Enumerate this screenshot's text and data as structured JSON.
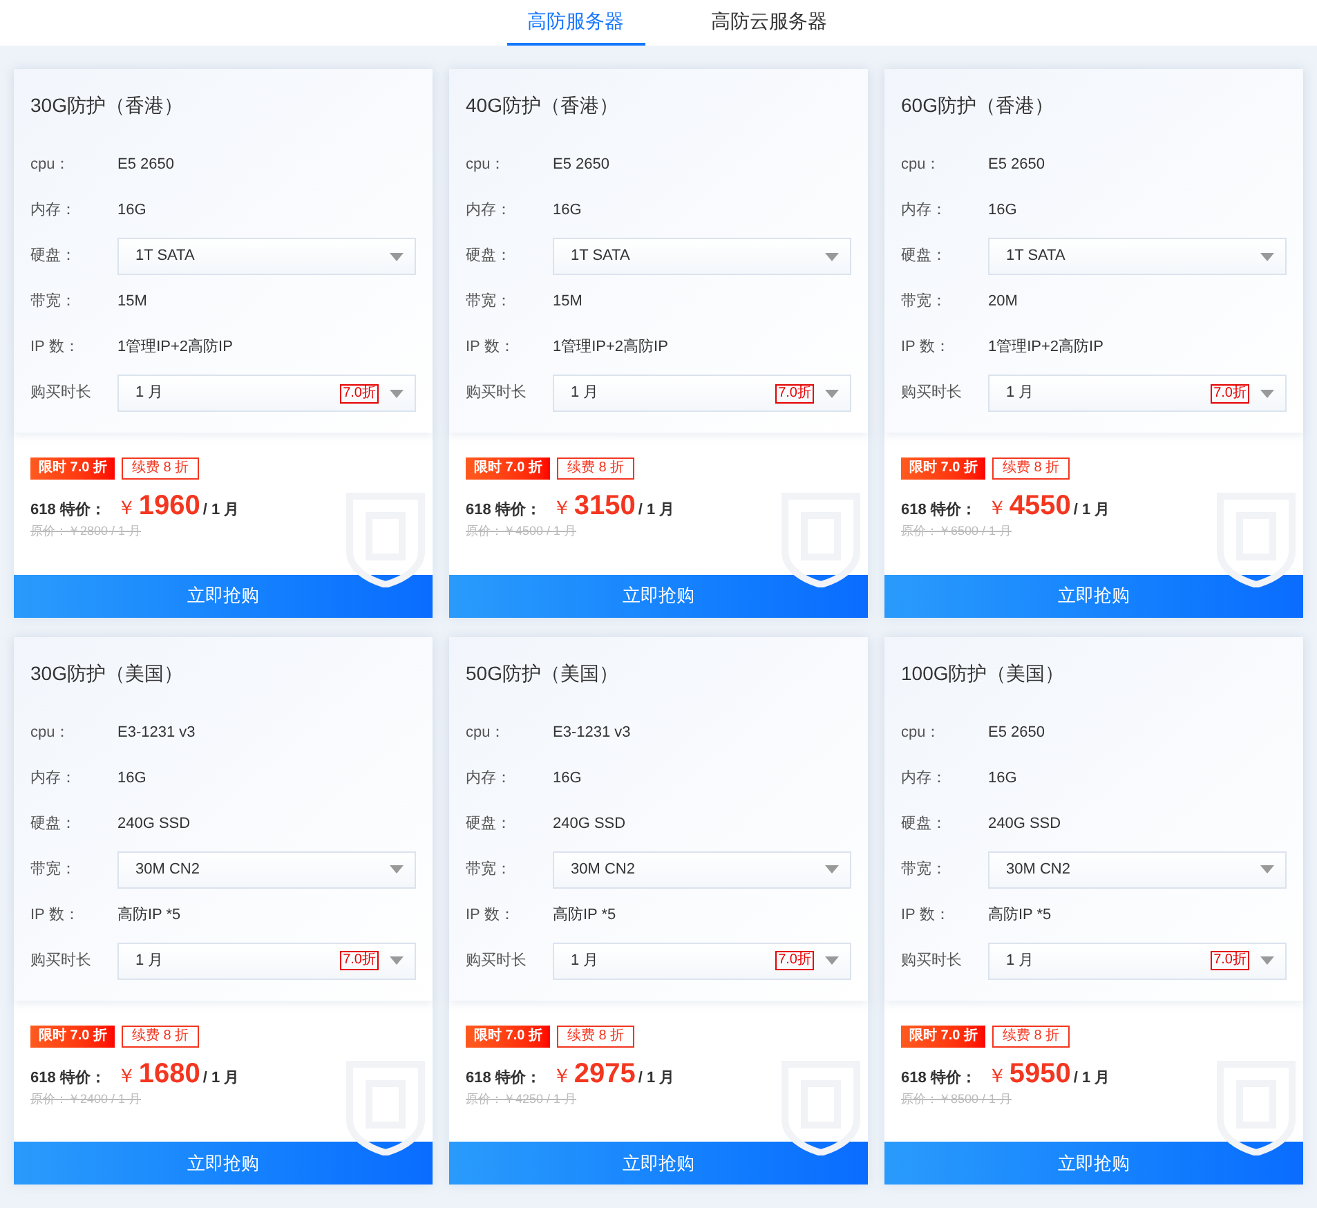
{
  "tabs": [
    {
      "label": "高防服务器",
      "selected": true
    },
    {
      "label": "高防云服务器",
      "selected": false
    }
  ],
  "cards": [
    {
      "title": "30G防护（香港）",
      "specs": [
        {
          "kind": "text",
          "label": "cpu：",
          "value": "E5 2650"
        },
        {
          "kind": "text",
          "label": "内存：",
          "value": "16G"
        },
        {
          "kind": "select",
          "label": "硬盘：",
          "value": "1T SATA"
        },
        {
          "kind": "text",
          "label": "带宽：",
          "value": "15M"
        },
        {
          "kind": "text",
          "label": "IP 数：",
          "value": "1管理IP+2高防IP"
        },
        {
          "kind": "select",
          "label": "购买时长",
          "value": "1 月",
          "tag": "7.0折"
        }
      ],
      "badges": [
        "限时 7.0 折",
        "续费 8 折"
      ],
      "price_label": "618 特价：",
      "currency": "￥",
      "price": "1960",
      "unit": "/ 1 月",
      "original": "原价：￥2800 / 1 月",
      "button": "立即抢购"
    },
    {
      "title": "40G防护（香港）",
      "specs": [
        {
          "kind": "text",
          "label": "cpu：",
          "value": "E5 2650"
        },
        {
          "kind": "text",
          "label": "内存：",
          "value": "16G"
        },
        {
          "kind": "select",
          "label": "硬盘：",
          "value": "1T SATA"
        },
        {
          "kind": "text",
          "label": "带宽：",
          "value": "15M"
        },
        {
          "kind": "text",
          "label": "IP 数：",
          "value": "1管理IP+2高防IP"
        },
        {
          "kind": "select",
          "label": "购买时长",
          "value": "1 月",
          "tag": "7.0折"
        }
      ],
      "badges": [
        "限时 7.0 折",
        "续费 8 折"
      ],
      "price_label": "618 特价：",
      "currency": "￥",
      "price": "3150",
      "unit": "/ 1 月",
      "original": "原价：￥4500 / 1 月",
      "button": "立即抢购"
    },
    {
      "title": "60G防护（香港）",
      "specs": [
        {
          "kind": "text",
          "label": "cpu：",
          "value": "E5 2650"
        },
        {
          "kind": "text",
          "label": "内存：",
          "value": "16G"
        },
        {
          "kind": "select",
          "label": "硬盘：",
          "value": "1T SATA"
        },
        {
          "kind": "text",
          "label": "带宽：",
          "value": "20M"
        },
        {
          "kind": "text",
          "label": "IP 数：",
          "value": "1管理IP+2高防IP"
        },
        {
          "kind": "select",
          "label": "购买时长",
          "value": "1 月",
          "tag": "7.0折"
        }
      ],
      "badges": [
        "限时 7.0 折",
        "续费 8 折"
      ],
      "price_label": "618 特价：",
      "currency": "￥",
      "price": "4550",
      "unit": "/ 1 月",
      "original": "原价：￥6500 / 1 月",
      "button": "立即抢购"
    },
    {
      "title": "30G防护（美国）",
      "specs": [
        {
          "kind": "text",
          "label": "cpu：",
          "value": "E3-1231 v3"
        },
        {
          "kind": "text",
          "label": "内存：",
          "value": "16G"
        },
        {
          "kind": "text",
          "label": "硬盘：",
          "value": "240G SSD"
        },
        {
          "kind": "select",
          "label": "带宽：",
          "value": "30M CN2"
        },
        {
          "kind": "text",
          "label": "IP 数：",
          "value": "高防IP *5"
        },
        {
          "kind": "select",
          "label": "购买时长",
          "value": "1 月",
          "tag": "7.0折"
        }
      ],
      "badges": [
        "限时 7.0 折",
        "续费 8 折"
      ],
      "price_label": "618 特价：",
      "currency": "￥",
      "price": "1680",
      "unit": "/ 1 月",
      "original": "原价：￥2400 / 1 月",
      "button": "立即抢购"
    },
    {
      "title": "50G防护（美国）",
      "specs": [
        {
          "kind": "text",
          "label": "cpu：",
          "value": "E3-1231 v3"
        },
        {
          "kind": "text",
          "label": "内存：",
          "value": "16G"
        },
        {
          "kind": "text",
          "label": "硬盘：",
          "value": "240G SSD"
        },
        {
          "kind": "select",
          "label": "带宽：",
          "value": "30M CN2"
        },
        {
          "kind": "text",
          "label": "IP 数：",
          "value": "高防IP *5"
        },
        {
          "kind": "select",
          "label": "购买时长",
          "value": "1 月",
          "tag": "7.0折"
        }
      ],
      "badges": [
        "限时 7.0 折",
        "续费 8 折"
      ],
      "price_label": "618 特价：",
      "currency": "￥",
      "price": "2975",
      "unit": "/ 1 月",
      "original": "原价：￥4250 / 1 月",
      "button": "立即抢购"
    },
    {
      "title": "100G防护（美国）",
      "specs": [
        {
          "kind": "text",
          "label": "cpu：",
          "value": "E5 2650"
        },
        {
          "kind": "text",
          "label": "内存：",
          "value": "16G"
        },
        {
          "kind": "text",
          "label": "硬盘：",
          "value": "240G SSD"
        },
        {
          "kind": "select",
          "label": "带宽：",
          "value": "30M CN2"
        },
        {
          "kind": "text",
          "label": "IP 数：",
          "value": "高防IP *5"
        },
        {
          "kind": "select",
          "label": "购买时长",
          "value": "1 月",
          "tag": "7.0折"
        }
      ],
      "badges": [
        "限时 7.0 折",
        "续费 8 折"
      ],
      "price_label": "618 特价：",
      "currency": "￥",
      "price": "5950",
      "unit": "/ 1 月",
      "original": "原价：￥8500 / 1 月",
      "button": "立即抢购"
    }
  ]
}
